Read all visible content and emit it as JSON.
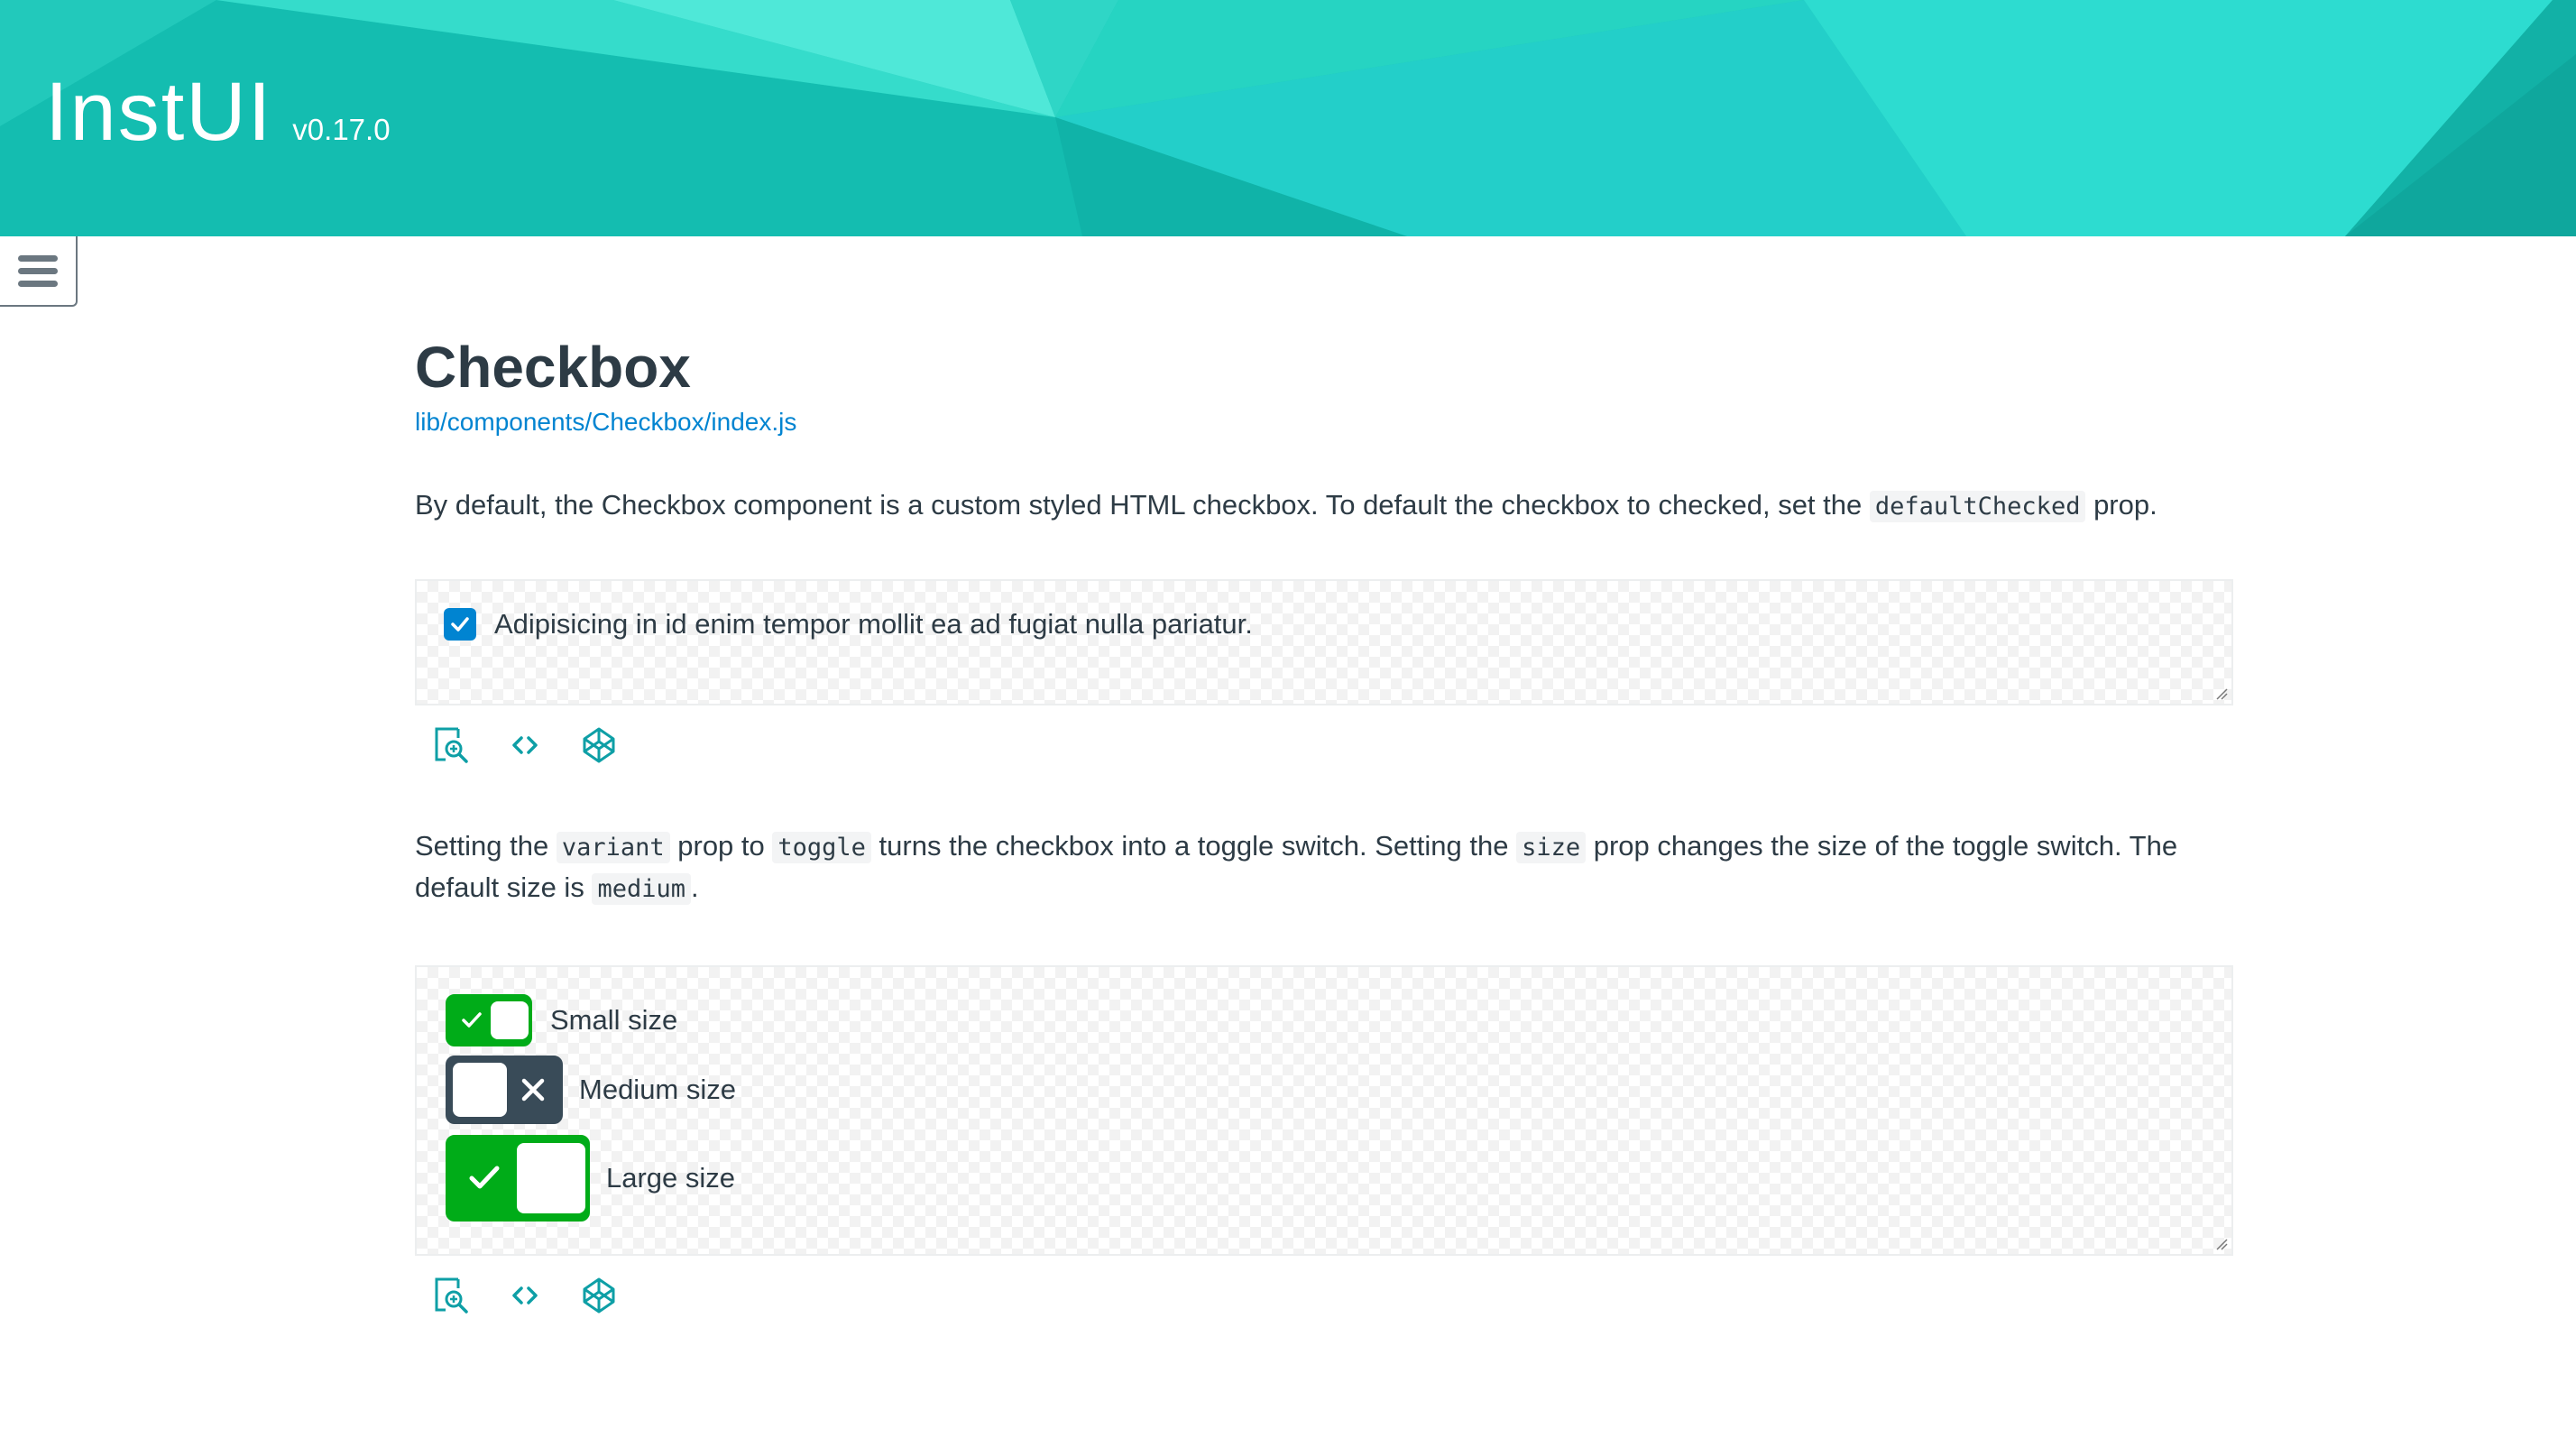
{
  "header": {
    "brand": "InstUI",
    "version": "v0.17.0"
  },
  "menu": {
    "icon": "hamburger-icon"
  },
  "page": {
    "title": "Checkbox",
    "source_path": "lib/components/Checkbox/index.js",
    "intro": {
      "before": "By default, the Checkbox component is a custom styled HTML checkbox. To default the checkbox to checked, set the ",
      "code": "defaultChecked",
      "after": " prop."
    }
  },
  "example1": {
    "checkbox_label": "Adipisicing in id enim tempor mollit ea ad fugiat nulla pariatur.",
    "checked": true,
    "tools": [
      "preview-fullscreen-icon",
      "code-icon",
      "codepen-icon"
    ]
  },
  "toggle_section": {
    "t1": "Setting the ",
    "c1": "variant",
    "t2": " prop to ",
    "c2": "toggle",
    "t3": " turns the checkbox into a toggle switch. Setting the ",
    "c3": "size",
    "t4": " prop changes the size of the toggle switch. The default size is ",
    "c4": "medium",
    "t5": "."
  },
  "example2": {
    "toggles": [
      {
        "label": "Small size",
        "size": "small",
        "checked": true
      },
      {
        "label": "Medium size",
        "size": "medium",
        "checked": false
      },
      {
        "label": "Large size",
        "size": "large",
        "checked": true
      }
    ],
    "tools": [
      "preview-fullscreen-icon",
      "code-icon",
      "codepen-icon"
    ]
  },
  "colors": {
    "brand_teal": "#1ec8b8",
    "link": "#0084d1",
    "checkbox": "#0084d1",
    "toggle_on": "#00ac18",
    "toggle_off": "#394b58",
    "tool_icon": "#008ee2"
  }
}
